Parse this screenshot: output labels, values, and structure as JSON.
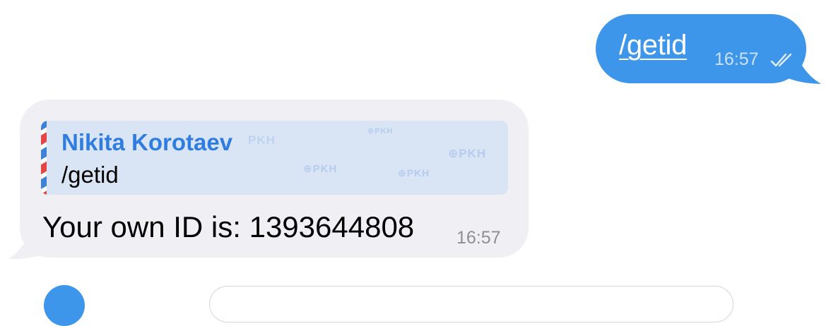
{
  "outgoing": {
    "command": "/getid",
    "time": "16:57",
    "status_icon": "double-check-icon",
    "bubble_color": "#3e96ea"
  },
  "incoming": {
    "reply": {
      "sender": "Nikita Korotaev",
      "text": "/getid",
      "watermark": "PKH"
    },
    "text": "Your own ID is: 1393644808",
    "time": "16:57",
    "bubble_color": "#efeff4"
  },
  "colors": {
    "accent": "#2f7de1",
    "reply_background": "#d9e5f5"
  }
}
